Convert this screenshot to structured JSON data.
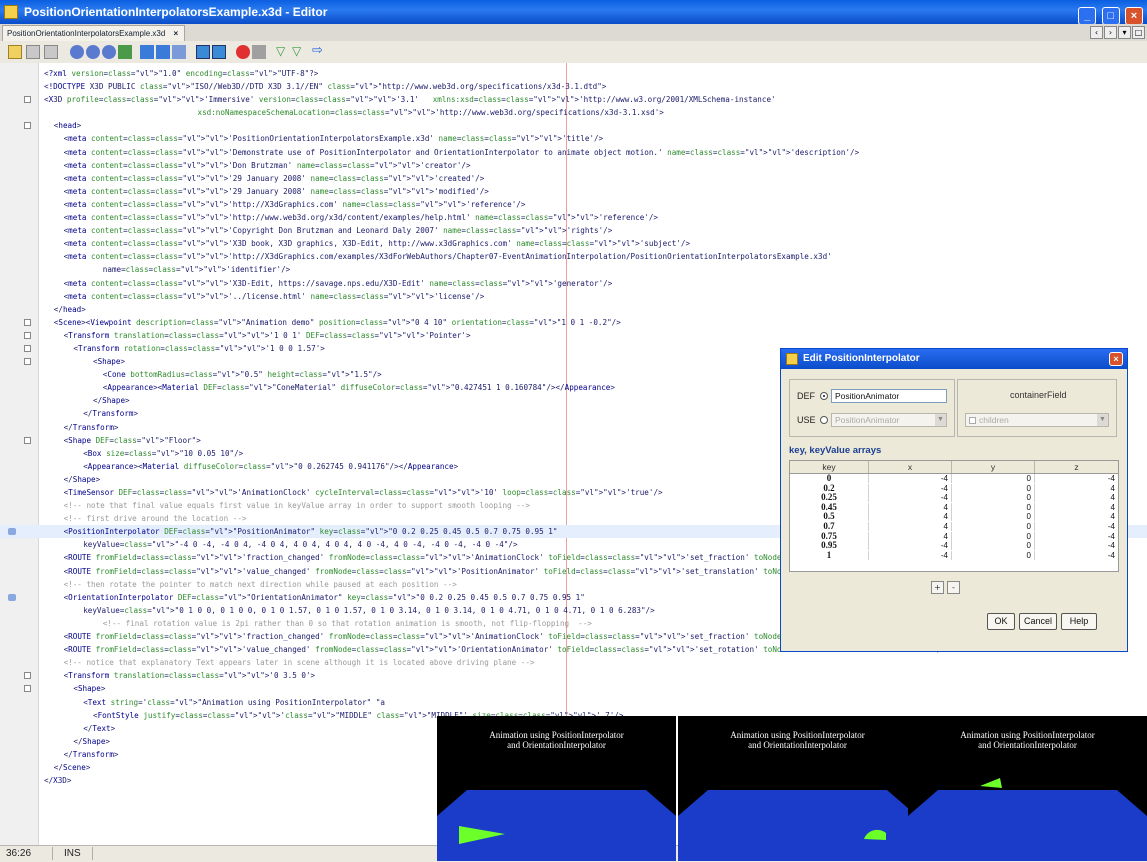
{
  "window": {
    "title": "PositionOrientationInterpolatorsExample.x3d - Editor",
    "tab_label": "PositionOrientationInterpolatorsExample.x3d",
    "tab_close": "×",
    "controls": {
      "minimize": "_",
      "maximize": "□",
      "close": "×"
    }
  },
  "toolbar": {
    "icons": [
      "back-icon",
      "forward-icon",
      "dropdown-icon",
      "find-icon",
      "find-prev-icon",
      "find-next-icon",
      "toggle-highlight-icon",
      "prev-bookmark-icon",
      "next-bookmark-icon",
      "toggle-bookmark-icon",
      "shift-left-icon",
      "shift-right-icon",
      "record-macro-icon",
      "stop-macro-icon",
      "check-file-icon",
      "validate-icon",
      "run-icon"
    ]
  },
  "editor": {
    "lines": [
      {
        "g": "",
        "text": "<?xml version=\"1.0\" encoding=\"UTF-8\"?>",
        "indent": 0
      },
      {
        "g": "",
        "text": "<!DOCTYPE X3D PUBLIC \"ISO//Web3D//DTD X3D 3.1//EN\" \"http://www.web3d.org/specifications/x3d-3.1.dtd\">",
        "indent": 0
      },
      {
        "g": "fold",
        "text": "<X3D profile='Immersive' version='3.1'   xmlns:xsd='http://www.w3.org/2001/XMLSchema-instance'",
        "indent": 0
      },
      {
        "g": "",
        "text": "          xsd:noNamespaceSchemaLocation='http://www.web3d.org/specifications/x3d-3.1.xsd'>",
        "indent": 11
      },
      {
        "g": "fold",
        "text": "<head>",
        "indent": 1
      },
      {
        "g": "",
        "text": "<meta content='PositionOrientationInterpolatorsExample.x3d' name='title'/>",
        "indent": 2
      },
      {
        "g": "",
        "text": "<meta content='Demonstrate use of PositionInterpolator and OrientationInterpolator to animate object motion.' name='description'/>",
        "indent": 2
      },
      {
        "g": "",
        "text": "<meta content='Don Brutzman' name='creator'/>",
        "indent": 2
      },
      {
        "g": "",
        "text": "<meta content='29 January 2008' name='created'/>",
        "indent": 2
      },
      {
        "g": "",
        "text": "<meta content='29 January 2008' name='modified'/>",
        "indent": 2
      },
      {
        "g": "",
        "text": "<meta content='http://X3dGraphics.com' name='reference'/>",
        "indent": 2
      },
      {
        "g": "",
        "text": "<meta content='http://www.web3d.org/x3d/content/examples/help.html' name='reference'/>",
        "indent": 2
      },
      {
        "g": "",
        "text": "<meta content='Copyright Don Brutzman and Leonard Daly 2007' name='rights'/>",
        "indent": 2
      },
      {
        "g": "",
        "text": "<meta content='X3D book, X3D graphics, X3D-Edit, http://www.x3dGraphics.com' name='subject'/>",
        "indent": 2
      },
      {
        "g": "",
        "text": "<meta content='http://X3dGraphics.com/examples/X3dForWebAuthors/Chapter07-EventAnimationInterpolation/PositionOrientationInterpolatorsExample.x3d'",
        "indent": 2
      },
      {
        "g": "",
        "text": "name='identifier'/>",
        "indent": 6
      },
      {
        "g": "",
        "text": "<meta content='X3D-Edit, https://savage.nps.edu/X3D-Edit' name='generator'/>",
        "indent": 2
      },
      {
        "g": "",
        "text": "<meta content='../license.html' name='license'/>",
        "indent": 2
      },
      {
        "g": "",
        "text": "</head>",
        "indent": 1
      },
      {
        "g": "fold",
        "text": "<Scene><Viewpoint description=\"Animation demo\" position=\"0 4 10\" orientation=\"1 0 1 -0.2\"/>",
        "indent": 1
      },
      {
        "g": "fold",
        "text": "<Transform translation='1 0 1' DEF='Pointer'>",
        "indent": 2
      },
      {
        "g": "fold",
        "text": "<Transform rotation='1 0 0 1.57'>",
        "indent": 3
      },
      {
        "g": "fold",
        "text": "<Shape>",
        "indent": 5
      },
      {
        "g": "",
        "text": "<Cone bottomRadius=\"0.5\" height=\"1.5\"/>",
        "indent": 6
      },
      {
        "g": "",
        "text": "<Appearance><Material DEF=\"ConeMaterial\" diffuseColor=\"0.427451 1 0.160784\"/></Appearance>",
        "indent": 6
      },
      {
        "g": "",
        "text": "</Shape>",
        "indent": 5
      },
      {
        "g": "",
        "text": "</Transform>",
        "indent": 4
      },
      {
        "g": "",
        "text": "</Transform>",
        "indent": 2
      },
      {
        "g": "fold",
        "text": "<Shape DEF=\"Floor\">",
        "indent": 2
      },
      {
        "g": "",
        "text": "<Box size=\"10 0.05 10\"/>",
        "indent": 4
      },
      {
        "g": "",
        "text": "<Appearance><Material diffuseColor=\"0 0.262745 0.941176\"/></Appearance>",
        "indent": 4
      },
      {
        "g": "",
        "text": "</Shape>",
        "indent": 2
      },
      {
        "g": "",
        "text": "<TimeSensor DEF='AnimationClock' cycleInterval='10' loop='true'/>",
        "indent": 2
      },
      {
        "g": "",
        "text": "<!-- note that final value equals first value in keyValue array in order to support smooth looping -->",
        "indent": 2
      },
      {
        "g": "",
        "text": "<!-- first drive around the location -->",
        "indent": 2
      },
      {
        "g": "arrow",
        "text": "<PositionInterpolator DEF=\"PositionAnimator\" key=\"0 0.2 0.25 0.45 0.5 0.7 0.75 0.95 1\"",
        "indent": 2,
        "hl": true
      },
      {
        "g": "",
        "text": "keyValue=\"-4 0 -4, -4 0 4, -4 0 4, 4 0 4, 4 0 4, 4 0 -4, 4 0 -4, -4 0 -4, -4 0 -4\"/>",
        "indent": 4
      },
      {
        "g": "",
        "text": "<ROUTE fromField='fraction_changed' fromNode='AnimationClock' toField='set_fraction' toNode='PositionAnimator'/>",
        "indent": 2
      },
      {
        "g": "",
        "text": "<ROUTE fromField='value_changed' fromNode='PositionAnimator' toField='set_translation' toNode='Pointer'/>",
        "indent": 2
      },
      {
        "g": "",
        "text": "<!-- then rotate the pointer to match next direction while paused at each position -->",
        "indent": 2
      },
      {
        "g": "arrow",
        "text": "<OrientationInterpolator DEF=\"OrientationAnimator\" key=\"0 0.2 0.25 0.45 0.5 0.7 0.75 0.95 1\"",
        "indent": 2
      },
      {
        "g": "",
        "text": "keyValue=\"0 1 0 0, 0 1 0 0, 0 1 0 1.57, 0 1 0 1.57, 0 1 0 3.14, 0 1 0 3.14, 0 1 0 4.71, 0 1 0 4.71, 0 1 0 6.283\"/>",
        "indent": 4
      },
      {
        "g": "",
        "text": "<!-- final rotation value is 2pi rather than 0 so that rotation animation is smooth, not flip-flopping  -->",
        "indent": 6
      },
      {
        "g": "",
        "text": "<ROUTE fromField='fraction_changed' fromNode='AnimationClock' toField='set_fraction' toNode='OrientationAnimator'/>",
        "indent": 2
      },
      {
        "g": "",
        "text": "<ROUTE fromField='value_changed' fromNode='OrientationAnimator' toField='set_rotation' toNode='Pointer'/>",
        "indent": 2
      },
      {
        "g": "",
        "text": "<!-- notice that explanatory Text appears later in scene although it is located above driving plane -->",
        "indent": 2
      },
      {
        "g": "fold",
        "text": "<Transform translation='0 3.5 0'>",
        "indent": 2
      },
      {
        "g": "fold",
        "text": "<Shape>",
        "indent": 3
      },
      {
        "g": "",
        "text": "<Text string='\"Animation using PositionInterpolator\" \"a",
        "indent": 4
      },
      {
        "g": "",
        "text": "<FontStyle justify='\"MIDDLE\" \"MIDDLE\"' size='.7'/>",
        "indent": 5
      },
      {
        "g": "",
        "text": "</Text>",
        "indent": 4
      },
      {
        "g": "",
        "text": "</Shape>",
        "indent": 3
      },
      {
        "g": "",
        "text": "</Transform>",
        "indent": 2
      },
      {
        "g": "",
        "text": "</Scene>",
        "indent": 1
      },
      {
        "g": "",
        "text": "</X3D>",
        "indent": 0
      }
    ]
  },
  "status": {
    "position": "36:26",
    "mode": "INS"
  },
  "dialog": {
    "title": "Edit PositionInterpolator",
    "close": "×",
    "def_label": "DEF",
    "def_value": "PositionAnimator",
    "use_label": "USE",
    "use_value": "PositionAnimator",
    "container_label": "containerField",
    "container_value": "children",
    "arrays_label": "key, keyValue arrays",
    "columns": [
      "key",
      "x",
      "y",
      "z"
    ],
    "rows": [
      [
        "0",
        "-4",
        "0",
        "-4"
      ],
      [
        "0.2",
        "-4",
        "0",
        "4"
      ],
      [
        "0.25",
        "-4",
        "0",
        "4"
      ],
      [
        "0.45",
        "4",
        "0",
        "4"
      ],
      [
        "0.5",
        "4",
        "0",
        "4"
      ],
      [
        "0.7",
        "4",
        "0",
        "-4"
      ],
      [
        "0.75",
        "4",
        "0",
        "-4"
      ],
      [
        "0.95",
        "-4",
        "0",
        "-4"
      ],
      [
        "1",
        "-4",
        "0",
        "-4"
      ]
    ],
    "add_label": "+",
    "remove_label": "-",
    "ok_label": "OK",
    "cancel_label": "Cancel",
    "help_label": "Help"
  },
  "viewports": [
    {
      "caption_line1": "Animation using PositionInterpolator",
      "caption_line2": "and OrientationInterpolator"
    },
    {
      "caption_line1": "Animation using PositionInterpolator",
      "caption_line2": "and OrientationInterpolator"
    },
    {
      "caption_line1": "Animation using PositionInterpolator",
      "caption_line2": "and OrientationInterpolator"
    }
  ],
  "colors": {
    "floor": "#1a3cc8",
    "cone": "#6dff29",
    "background": "#000000"
  }
}
